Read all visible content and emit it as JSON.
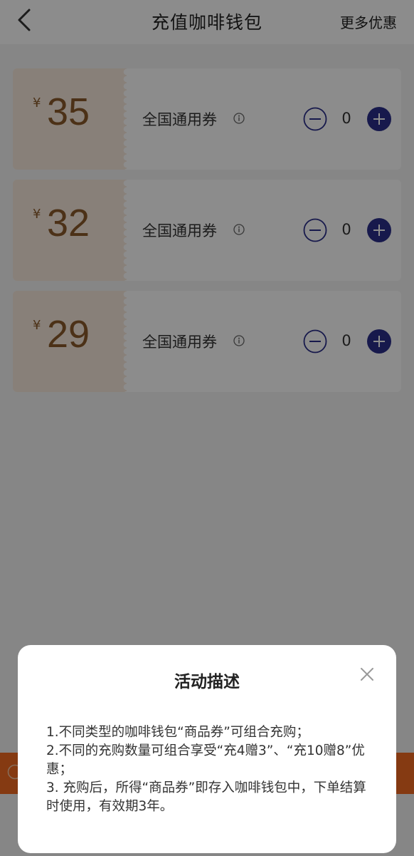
{
  "header": {
    "title": "充值咖啡钱包",
    "more_label": "更多优惠"
  },
  "coupons": [
    {
      "currency": "¥",
      "amount": "35",
      "label": "全国通用券",
      "quantity": "0"
    },
    {
      "currency": "¥",
      "amount": "32",
      "label": "全国通用券",
      "quantity": "0"
    },
    {
      "currency": "¥",
      "amount": "29",
      "label": "全国通用券",
      "quantity": "0"
    }
  ],
  "modal": {
    "title": "活动描述",
    "lines": [
      "1.不同类型的咖啡钱包“商品券”可组合充购；",
      "2.不同的充购数量可组合享受“充4赠3”、“充10赠8”优惠；",
      "3. 充购后，所得“商品券”即存入咖啡钱包中，下单结算时使用，有效期3年。"
    ]
  },
  "colors": {
    "accent_button": "#2b2f8a",
    "coupon_price": "#8a5a2a",
    "coupon_bg": "#f7eadc",
    "bottom_bar": "#f26b22"
  },
  "icons": {
    "back": "chevron-left-icon",
    "info": "info-icon",
    "minus": "minus-circle-icon",
    "plus": "plus-circle-icon",
    "close": "close-icon"
  }
}
